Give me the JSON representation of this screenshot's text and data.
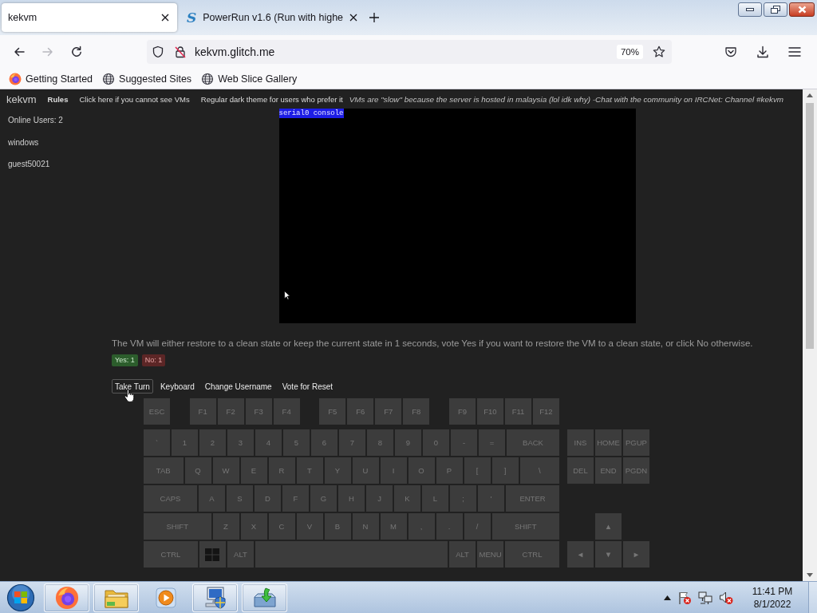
{
  "browser": {
    "tabs": [
      {
        "title": "kekvm",
        "selected": true
      },
      {
        "title": "PowerRun v1.6 (Run with highe",
        "logo": "S",
        "selected": false
      }
    ],
    "nav_buttons": [
      {
        "kind": "back",
        "disabled": false
      },
      {
        "kind": "forward",
        "disabled": true
      },
      {
        "kind": "reload",
        "disabled": false
      }
    ],
    "address_bar": {
      "url": "kekvm.glitch.me",
      "zoom": "70%"
    },
    "bookmarks": [
      {
        "label": "Getting Started",
        "kind": "firefox"
      },
      {
        "label": "Suggested Sites",
        "kind": "globe"
      },
      {
        "label": "Web Slice Gallery",
        "kind": "globe"
      }
    ]
  },
  "page": {
    "header": {
      "logo": "kekvm",
      "links": [
        {
          "label": "Rules",
          "bold": true
        },
        {
          "label": "Click here if you cannot see VMs",
          "bold": false
        },
        {
          "label": "Regular dark theme for users who prefer it",
          "bold": false
        }
      ],
      "notice": "VMs are \"slow\" because the server is hosted in malaysia (lol idk why) -Chat with the community on IRCNet: Channel #kekvm"
    },
    "sidebar": {
      "online_users": "Online Users: 2",
      "users": [
        "windows",
        "guest50021"
      ]
    },
    "vm_screen": {
      "console_title": "serial0 console"
    },
    "vote": {
      "message": "The VM will either restore to a clean state or keep the current state in 1 seconds, vote Yes if you want to restore the VM to a clean state, or click No otherwise.",
      "badges": [
        {
          "label": "Yes: 1",
          "kind": "yes"
        },
        {
          "label": "No: 1",
          "kind": "no"
        }
      ]
    },
    "actions": [
      {
        "label": "Take Turn",
        "hovered": true
      },
      {
        "label": "Keyboard",
        "hovered": false
      },
      {
        "label": "Change Username",
        "hovered": false
      },
      {
        "label": "Vote for Reset",
        "hovered": false
      }
    ],
    "keyboard": {
      "function_groups": [
        {
          "keys": [
            "ESC"
          ]
        },
        {
          "keys": [
            "F1",
            "F2",
            "F3",
            "F4"
          ]
        },
        {
          "keys": [
            "F5",
            "F6",
            "F7",
            "F8"
          ]
        },
        {
          "keys": [
            "F9",
            "F10",
            "F11",
            "F12"
          ]
        }
      ],
      "rows": [
        {
          "keys": [
            {
              "label": "`",
              "kind": "key"
            },
            {
              "label": "1",
              "kind": "key"
            },
            {
              "label": "2",
              "kind": "key"
            },
            {
              "label": "3",
              "kind": "key"
            },
            {
              "label": "4",
              "kind": "key"
            },
            {
              "label": "5",
              "kind": "key"
            },
            {
              "label": "6",
              "kind": "key"
            },
            {
              "label": "7",
              "kind": "key"
            },
            {
              "label": "8",
              "kind": "key"
            },
            {
              "label": "9",
              "kind": "key"
            },
            {
              "label": "0",
              "kind": "key"
            },
            {
              "label": "-",
              "kind": "key"
            },
            {
              "label": "=",
              "kind": "key"
            },
            {
              "label": "BACK",
              "kind": "wide"
            }
          ]
        },
        {
          "keys": [
            {
              "label": "TAB",
              "kind": "wide"
            },
            {
              "label": "Q",
              "kind": "key"
            },
            {
              "label": "W",
              "kind": "key"
            },
            {
              "label": "E",
              "kind": "key"
            },
            {
              "label": "R",
              "kind": "key"
            },
            {
              "label": "T",
              "kind": "key"
            },
            {
              "label": "Y",
              "kind": "key"
            },
            {
              "label": "U",
              "kind": "key"
            },
            {
              "label": "I",
              "kind": "key"
            },
            {
              "label": "O",
              "kind": "key"
            },
            {
              "label": "P",
              "kind": "key"
            },
            {
              "label": "[",
              "kind": "key"
            },
            {
              "label": "]",
              "kind": "key"
            },
            {
              "label": "\\",
              "kind": "wide"
            }
          ]
        },
        {
          "keys": [
            {
              "label": "CAPS",
              "kind": "wide"
            },
            {
              "label": "A",
              "kind": "key"
            },
            {
              "label": "S",
              "kind": "key"
            },
            {
              "label": "D",
              "kind": "key"
            },
            {
              "label": "F",
              "kind": "key"
            },
            {
              "label": "G",
              "kind": "key"
            },
            {
              "label": "H",
              "kind": "key"
            },
            {
              "label": "J",
              "kind": "key"
            },
            {
              "label": "K",
              "kind": "key"
            },
            {
              "label": "L",
              "kind": "key"
            },
            {
              "label": ";",
              "kind": "key"
            },
            {
              "label": "'",
              "kind": "key"
            },
            {
              "label": "ENTER",
              "kind": "wide"
            }
          ]
        },
        {
          "keys": [
            {
              "label": "SHIFT",
              "kind": "wide"
            },
            {
              "label": "Z",
              "kind": "key"
            },
            {
              "label": "X",
              "kind": "key"
            },
            {
              "label": "C",
              "kind": "key"
            },
            {
              "label": "V",
              "kind": "key"
            },
            {
              "label": "B",
              "kind": "key"
            },
            {
              "label": "N",
              "kind": "key"
            },
            {
              "label": "M",
              "kind": "key"
            },
            {
              "label": ",",
              "kind": "key"
            },
            {
              "label": ".",
              "kind": "key"
            },
            {
              "label": "/",
              "kind": "key"
            },
            {
              "label": "SHIFT",
              "kind": "wide"
            }
          ]
        },
        {
          "keys": [
            {
              "label": "CTRL",
              "kind": "wide"
            },
            {
              "kind": "windows"
            },
            {
              "label": "ALT",
              "kind": "key"
            },
            {
              "kind": "space"
            },
            {
              "label": "ALT",
              "kind": "key"
            },
            {
              "label": "MENU",
              "kind": "key"
            },
            {
              "label": "CTRL",
              "kind": "wide"
            }
          ]
        }
      ],
      "nav_groups": [
        {
          "keys": [
            "INS",
            "HOME",
            "PGUP"
          ]
        },
        {
          "keys": [
            "DEL",
            "END",
            "PGDN"
          ]
        }
      ],
      "arrow_groups": [
        {
          "keys": [
            "▲"
          ]
        },
        {
          "keys": [
            "◄",
            "▼",
            "►"
          ]
        }
      ]
    }
  },
  "taskbar": {
    "apps": [
      {
        "kind": "firefox",
        "running": true
      },
      {
        "kind": "folder",
        "running": true
      },
      {
        "kind": "media",
        "running": false
      },
      {
        "kind": "computer",
        "running": true
      },
      {
        "kind": "installer",
        "running": true
      }
    ],
    "time": "11:41 PM",
    "date": "8/1/2022"
  }
}
